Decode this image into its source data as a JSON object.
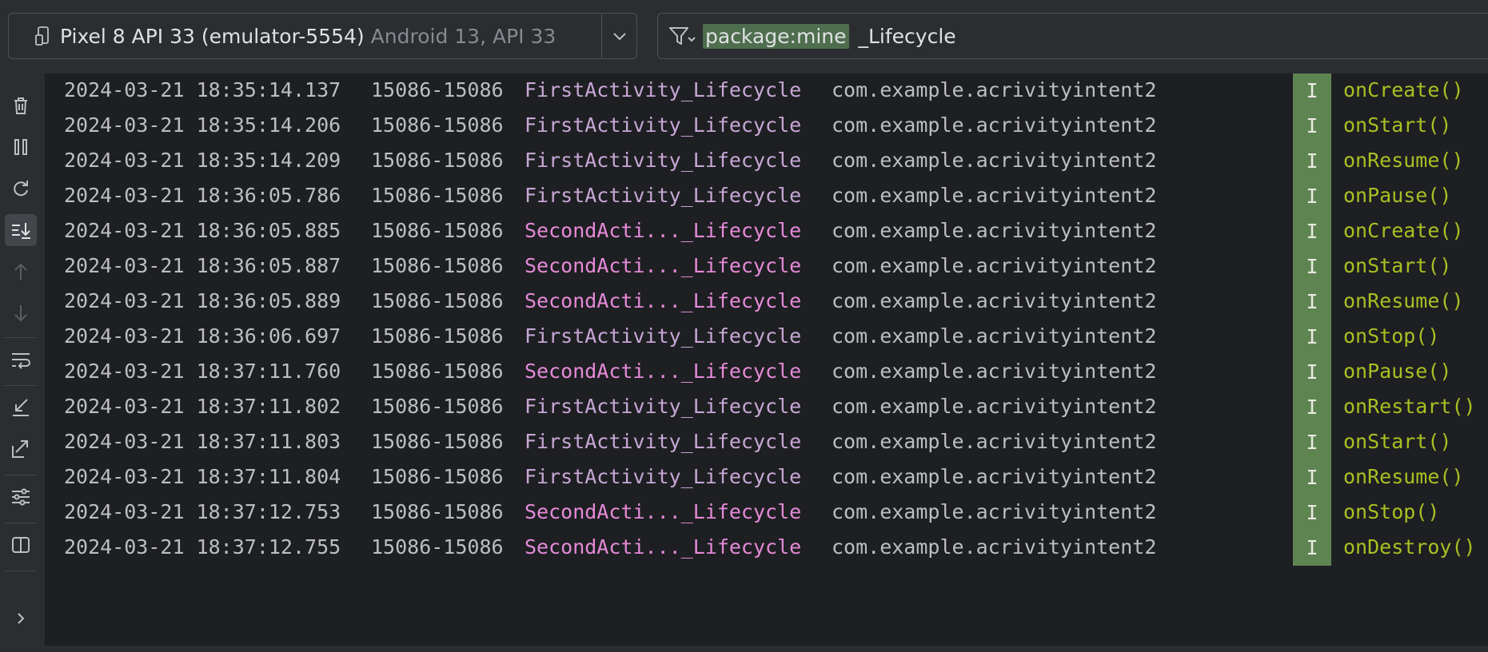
{
  "device": {
    "name": "Pixel 8 API 33 (emulator-5554)",
    "detail": "Android 13, API 33"
  },
  "filter": {
    "chip": "package:mine",
    "text": "_Lifecycle"
  },
  "sidebar_tools": [
    {
      "name": "clear-logcat-icon"
    },
    {
      "name": "pause-icon"
    },
    {
      "name": "restart-icon"
    },
    {
      "name": "scroll-to-end-icon"
    },
    {
      "name": "previous-occurrence-icon"
    },
    {
      "name": "next-occurrence-icon"
    },
    {
      "name": "soft-wrap-icon"
    },
    {
      "name": "fold-icon"
    },
    {
      "name": "unfold-icon"
    },
    {
      "name": "format-settings-icon"
    },
    {
      "name": "split-panels-icon"
    },
    {
      "name": "expand-chevron-icon"
    }
  ],
  "colors": {
    "background": "#1e1f22",
    "panel": "#2b2d30",
    "first_tag": "#c7a7d6",
    "second_tag": "#e58ad8",
    "level_bg": "#5e8452",
    "message": "#a8c023",
    "filter_chip": "#4e6e4e"
  },
  "log": [
    {
      "date": "2024-03-21 18:35:14.137",
      "pid": "15086-15086",
      "tag": "FirstActivity_Lifecycle",
      "tag_type": "first",
      "package": "com.example.acrivityintent2",
      "level": "I",
      "message": "onCreate()"
    },
    {
      "date": "2024-03-21 18:35:14.206",
      "pid": "15086-15086",
      "tag": "FirstActivity_Lifecycle",
      "tag_type": "first",
      "package": "com.example.acrivityintent2",
      "level": "I",
      "message": "onStart()"
    },
    {
      "date": "2024-03-21 18:35:14.209",
      "pid": "15086-15086",
      "tag": "FirstActivity_Lifecycle",
      "tag_type": "first",
      "package": "com.example.acrivityintent2",
      "level": "I",
      "message": "onResume()"
    },
    {
      "date": "2024-03-21 18:36:05.786",
      "pid": "15086-15086",
      "tag": "FirstActivity_Lifecycle",
      "tag_type": "first",
      "package": "com.example.acrivityintent2",
      "level": "I",
      "message": "onPause()"
    },
    {
      "date": "2024-03-21 18:36:05.885",
      "pid": "15086-15086",
      "tag": "SecondActi..._Lifecycle",
      "tag_type": "second",
      "package": "com.example.acrivityintent2",
      "level": "I",
      "message": "onCreate()"
    },
    {
      "date": "2024-03-21 18:36:05.887",
      "pid": "15086-15086",
      "tag": "SecondActi..._Lifecycle",
      "tag_type": "second",
      "package": "com.example.acrivityintent2",
      "level": "I",
      "message": "onStart()"
    },
    {
      "date": "2024-03-21 18:36:05.889",
      "pid": "15086-15086",
      "tag": "SecondActi..._Lifecycle",
      "tag_type": "second",
      "package": "com.example.acrivityintent2",
      "level": "I",
      "message": "onResume()"
    },
    {
      "date": "2024-03-21 18:36:06.697",
      "pid": "15086-15086",
      "tag": "FirstActivity_Lifecycle",
      "tag_type": "first",
      "package": "com.example.acrivityintent2",
      "level": "I",
      "message": "onStop()"
    },
    {
      "date": "2024-03-21 18:37:11.760",
      "pid": "15086-15086",
      "tag": "SecondActi..._Lifecycle",
      "tag_type": "second",
      "package": "com.example.acrivityintent2",
      "level": "I",
      "message": "onPause()"
    },
    {
      "date": "2024-03-21 18:37:11.802",
      "pid": "15086-15086",
      "tag": "FirstActivity_Lifecycle",
      "tag_type": "first",
      "package": "com.example.acrivityintent2",
      "level": "I",
      "message": "onRestart()"
    },
    {
      "date": "2024-03-21 18:37:11.803",
      "pid": "15086-15086",
      "tag": "FirstActivity_Lifecycle",
      "tag_type": "first",
      "package": "com.example.acrivityintent2",
      "level": "I",
      "message": "onStart()"
    },
    {
      "date": "2024-03-21 18:37:11.804",
      "pid": "15086-15086",
      "tag": "FirstActivity_Lifecycle",
      "tag_type": "first",
      "package": "com.example.acrivityintent2",
      "level": "I",
      "message": "onResume()"
    },
    {
      "date": "2024-03-21 18:37:12.753",
      "pid": "15086-15086",
      "tag": "SecondActi..._Lifecycle",
      "tag_type": "second",
      "package": "com.example.acrivityintent2",
      "level": "I",
      "message": "onStop()"
    },
    {
      "date": "2024-03-21 18:37:12.755",
      "pid": "15086-15086",
      "tag": "SecondActi..._Lifecycle",
      "tag_type": "second",
      "package": "com.example.acrivityintent2",
      "level": "I",
      "message": "onDestroy()"
    }
  ]
}
